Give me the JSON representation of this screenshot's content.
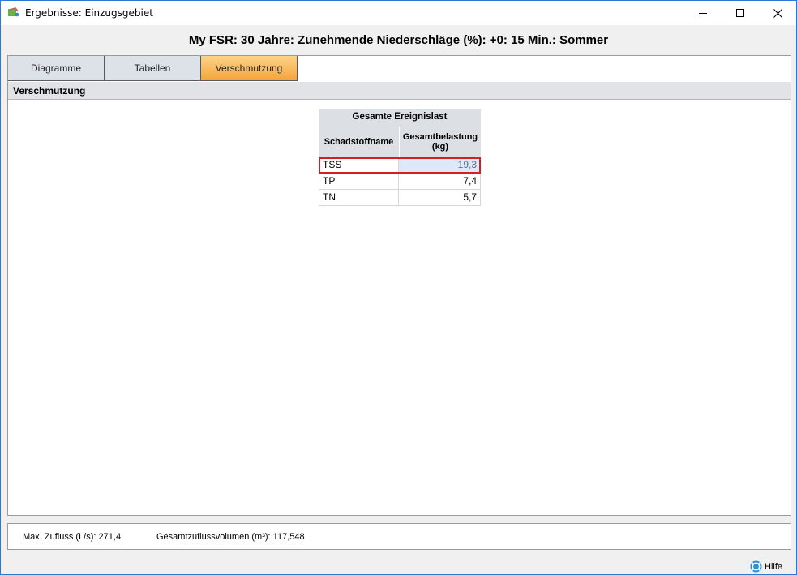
{
  "window": {
    "title": "Ergebnisse: Einzugsgebiet",
    "icons": {
      "app": "catchment-app-icon",
      "minimize": "minimize-icon",
      "maximize": "maximize-icon",
      "close": "close-icon"
    }
  },
  "heading": "My FSR: 30 Jahre: Zunehmende Niederschläge (%): +0: 15 Min.: Sommer",
  "tabs": [
    {
      "label": "Diagramme",
      "active": false
    },
    {
      "label": "Tabellen",
      "active": false
    },
    {
      "label": "Verschmutzung",
      "active": true
    }
  ],
  "section": {
    "title": "Verschmutzung"
  },
  "table": {
    "group_header": "Gesamte Ereignislast",
    "columns": [
      "Schadstoffname",
      "Gesamtbelastung (kg)"
    ],
    "rows": [
      {
        "name": "TSS",
        "value": "19,3",
        "selected": true
      },
      {
        "name": "TP",
        "value": "7,4",
        "selected": false
      },
      {
        "name": "TN",
        "value": "5,7",
        "selected": false
      }
    ]
  },
  "status": {
    "max_inflow_label": "Max. Zufluss (L/s):",
    "max_inflow_value": "271,4",
    "total_volume_label": "Gesamtzuflussvolumen (m³):",
    "total_volume_value": "117,548"
  },
  "help": {
    "label": "Hilfe",
    "icon": "help-icon"
  },
  "colors": {
    "accent_tab": "#f5a53a",
    "selection_border": "#d0201f",
    "window_border": "#2b79d6"
  }
}
